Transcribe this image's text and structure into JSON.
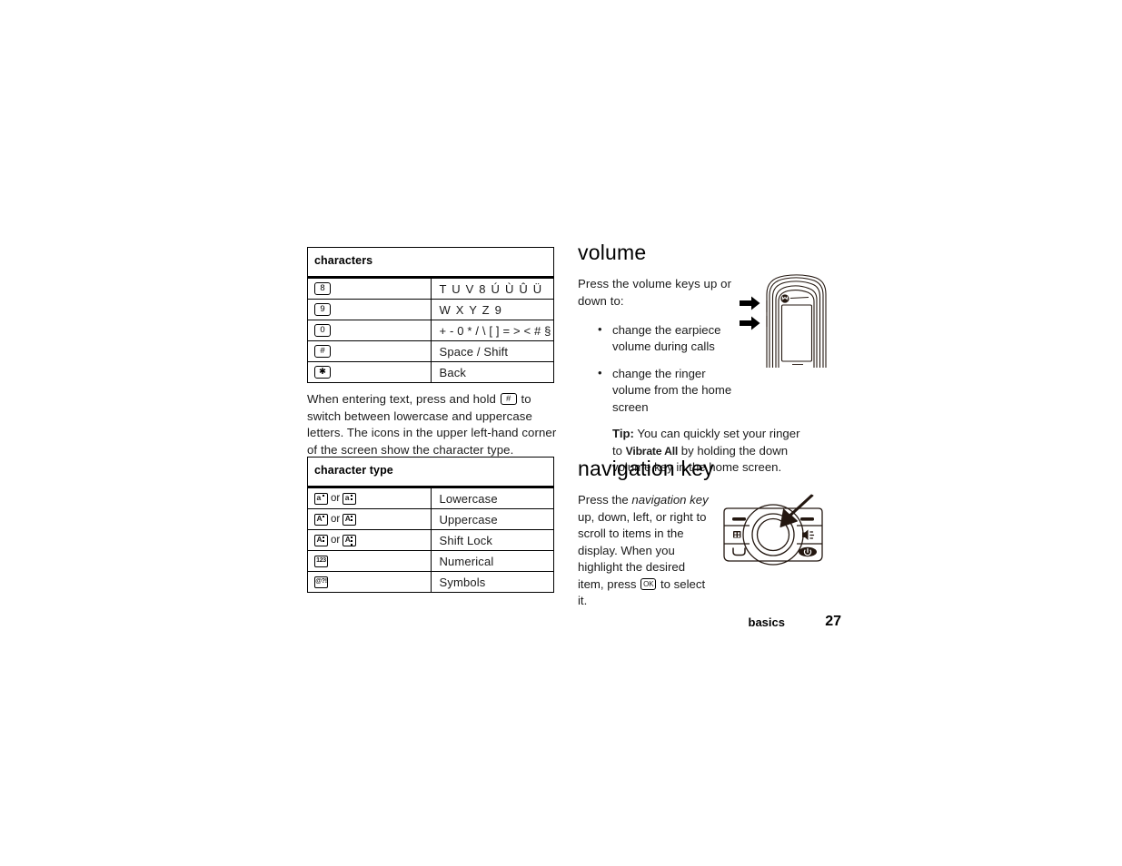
{
  "document": {
    "footer_chapter": "basics",
    "page_number": "27"
  },
  "characters_table": {
    "caption": "characters",
    "rows": [
      {
        "key": "8",
        "value": "T U V 8 Ú Ù Û Ü"
      },
      {
        "key": "9",
        "value": "W X Y Z 9"
      },
      {
        "key": "0",
        "value": "+ - 0 * / \\ [ ] = > < # §"
      },
      {
        "key": "#",
        "value": "Space / Shift"
      },
      {
        "key": "✱",
        "value": "Back"
      }
    ]
  },
  "entering_text_paragraph": {
    "part1": "When entering text, press and hold",
    "key_glyph": "#",
    "part2": "to switch between lowercase and uppercase letters. The icons in the upper left-hand corner of the screen show the character type."
  },
  "character_type_table": {
    "caption": "character type",
    "or_word": "or",
    "rows": [
      {
        "icon1": "a",
        "icon1_dots": 1,
        "icon2": "a",
        "icon2_dots": 2,
        "label": "Lowercase"
      },
      {
        "icon1": "A",
        "icon1_dots": 1,
        "icon2": "A",
        "icon2_dots": 2,
        "label": "Uppercase"
      },
      {
        "icon1": "A",
        "icon1_dots": 2,
        "icon2": "A",
        "icon2_dots": 3,
        "label": "Shift Lock"
      },
      {
        "icon1": "123",
        "icon1_dots": 0,
        "icon2": null,
        "icon2_dots": 0,
        "label": "Numerical"
      },
      {
        "icon1": "@?!",
        "icon1_dots": 0,
        "icon2": null,
        "icon2_dots": 0,
        "label": "Symbols"
      }
    ]
  },
  "volume": {
    "heading": "volume",
    "intro": "Press the volume keys up or down to:",
    "bullets": [
      "change the earpiece volume during calls",
      "change the ringer volume from the home screen"
    ],
    "tip": {
      "label": "Tip:",
      "text_before": "You can quickly set your ringer to",
      "emphasis": "Vibrate All",
      "text_after": "by holding the down volume key in the home screen."
    },
    "figure_name": "phone-side-volume-keys-illustration"
  },
  "navigation_key": {
    "heading": "navigation key",
    "text_before": "Press the",
    "italic_term": "navigation key",
    "text_middle": "up, down, left, or right to scroll to items in the display. When you highlight the desired item, press",
    "ok_key_glyph": "OK",
    "text_after": "to select it.",
    "figure_name": "navigation-key-illustration"
  },
  "colors": {
    "ink": "#000000",
    "body_text": "#1a1a1a",
    "page_background": "#ffffff"
  }
}
